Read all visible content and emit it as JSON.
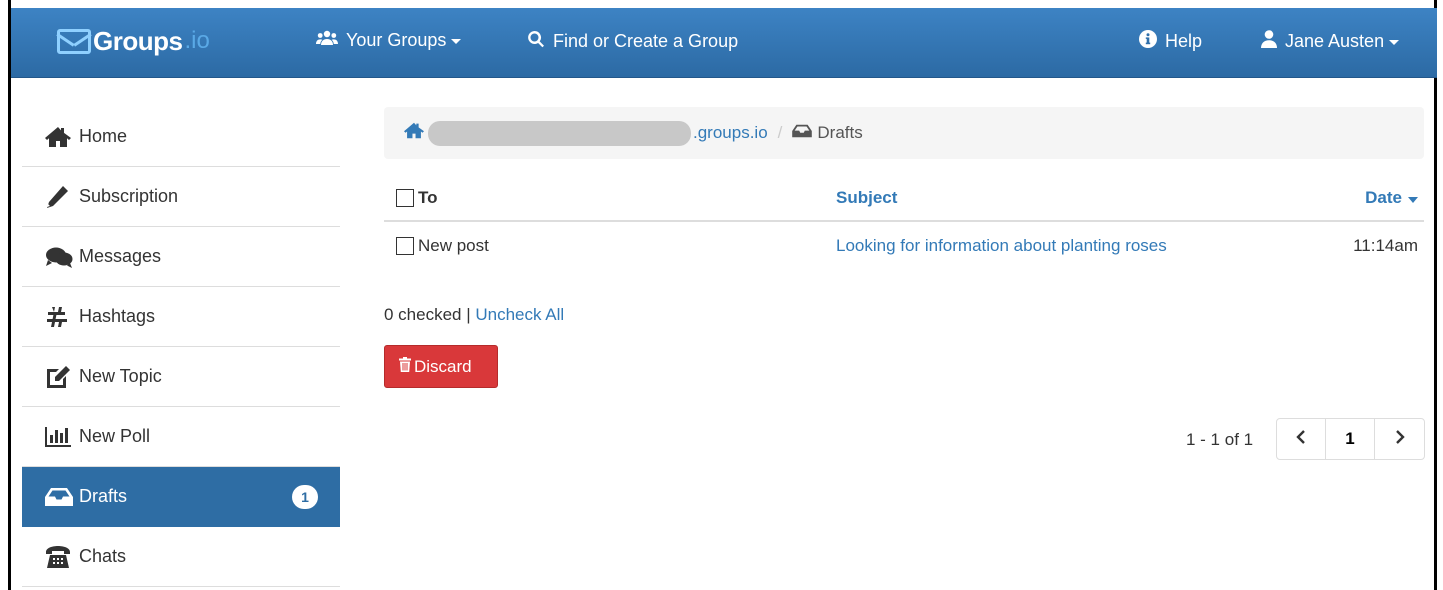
{
  "navbar": {
    "brand_name": "Groups",
    "brand_tld": ".io",
    "your_groups": "Your Groups",
    "find_create": "Find or Create a Group",
    "help": "Help",
    "user": "Jane Austen"
  },
  "sidebar": {
    "items": [
      {
        "label": "Home",
        "icon": "home-icon"
      },
      {
        "label": "Subscription",
        "icon": "pencil-icon"
      },
      {
        "label": "Messages",
        "icon": "comments-icon"
      },
      {
        "label": "Hashtags",
        "icon": "hashtag-icon"
      },
      {
        "label": "New Topic",
        "icon": "edit-icon"
      },
      {
        "label": "New Poll",
        "icon": "bar-chart-icon"
      },
      {
        "label": "Drafts",
        "icon": "inbox-icon",
        "badge": "1",
        "active": true
      },
      {
        "label": "Chats",
        "icon": "phone-icon"
      }
    ]
  },
  "breadcrumb": {
    "group_suffix": ".groups.io",
    "separator": "/",
    "current": "Drafts"
  },
  "table": {
    "headers": {
      "to": "To",
      "subject": "Subject",
      "date": "Date"
    },
    "rows": [
      {
        "to": "New post",
        "subject": "Looking for information about planting roses",
        "date": "11:14am"
      }
    ]
  },
  "selection": {
    "checked_text": "0 checked |",
    "uncheck_all": "Uncheck All"
  },
  "actions": {
    "discard": "Discard"
  },
  "pagination": {
    "info": "1 - 1 of 1",
    "prev": "‹",
    "current_page": "1",
    "next": "›"
  },
  "colors": {
    "navbar": "#2c6aa4",
    "link": "#337ab7",
    "active_item": "#2e6da4",
    "danger": "#d9383a"
  }
}
